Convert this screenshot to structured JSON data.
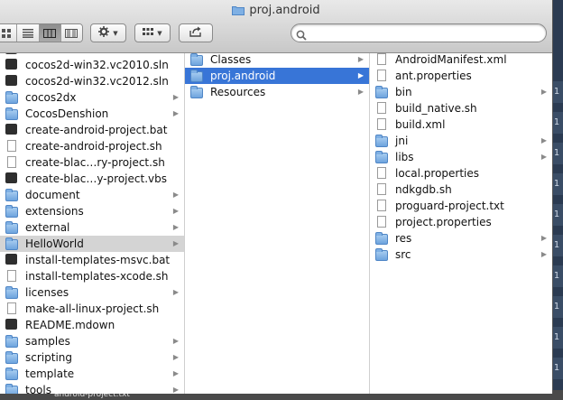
{
  "window": {
    "title": "proj.android",
    "search": {
      "value": "",
      "placeholder": ""
    }
  },
  "toolbar": {
    "view_modes": [
      "icon-view-icon",
      "list-view-icon",
      "column-view-icon",
      "coverflow-view-icon"
    ],
    "active_view": "column-view-icon",
    "action_icon": "gear-icon",
    "arrange_icon": "arrange-grid-icon",
    "share_icon": "share-icon"
  },
  "column1": {
    "partial_top_label": "cocos2d-win32.vc2010.sln",
    "items": [
      {
        "label": "cocos2d-win32.vc2010.sln",
        "kind": "exec",
        "arrow": false
      },
      {
        "label": "cocos2d-win32.vc2012.sln",
        "kind": "exec",
        "arrow": false
      },
      {
        "label": "cocos2dx",
        "kind": "folder",
        "arrow": true
      },
      {
        "label": "CocosDenshion",
        "kind": "folder",
        "arrow": true
      },
      {
        "label": "create-android-project.bat",
        "kind": "exec",
        "arrow": false
      },
      {
        "label": "create-android-project.sh",
        "kind": "doc",
        "arrow": false
      },
      {
        "label": "create-blac…ry-project.sh",
        "kind": "doc",
        "arrow": false
      },
      {
        "label": "create-blac…y-project.vbs",
        "kind": "exec",
        "arrow": false
      },
      {
        "label": "document",
        "kind": "folder",
        "arrow": true
      },
      {
        "label": "extensions",
        "kind": "folder",
        "arrow": true
      },
      {
        "label": "external",
        "kind": "folder",
        "arrow": true
      },
      {
        "label": "HelloWorld",
        "kind": "folder",
        "arrow": true,
        "selected": "gray"
      },
      {
        "label": "install-templates-msvc.bat",
        "kind": "exec",
        "arrow": false
      },
      {
        "label": "install-templates-xcode.sh",
        "kind": "doc",
        "arrow": false
      },
      {
        "label": "licenses",
        "kind": "folder",
        "arrow": true
      },
      {
        "label": "make-all-linux-project.sh",
        "kind": "doc",
        "arrow": false
      },
      {
        "label": "README.mdown",
        "kind": "exec",
        "arrow": false
      },
      {
        "label": "samples",
        "kind": "folder",
        "arrow": true
      },
      {
        "label": "scripting",
        "kind": "folder",
        "arrow": true
      },
      {
        "label": "template",
        "kind": "folder",
        "arrow": true
      },
      {
        "label": "tools",
        "kind": "folder",
        "arrow": true
      }
    ]
  },
  "column2": {
    "items": [
      {
        "label": "Classes",
        "kind": "folder",
        "arrow": true
      },
      {
        "label": "proj.android",
        "kind": "folder",
        "arrow": true,
        "selected": "blue"
      },
      {
        "label": "Resources",
        "kind": "folder",
        "arrow": true
      }
    ]
  },
  "column3": {
    "items": [
      {
        "label": "AndroidManifest.xml",
        "kind": "doc",
        "arrow": false
      },
      {
        "label": "ant.properties",
        "kind": "doc",
        "arrow": false
      },
      {
        "label": "bin",
        "kind": "folder",
        "arrow": true
      },
      {
        "label": "build_native.sh",
        "kind": "doc",
        "arrow": false
      },
      {
        "label": "build.xml",
        "kind": "doc",
        "arrow": false
      },
      {
        "label": "jni",
        "kind": "folder",
        "arrow": true
      },
      {
        "label": "libs",
        "kind": "folder",
        "arrow": true
      },
      {
        "label": "local.properties",
        "kind": "doc",
        "arrow": false
      },
      {
        "label": "ndkgdb.sh",
        "kind": "doc",
        "arrow": false
      },
      {
        "label": "proguard-project.txt",
        "kind": "doc",
        "arrow": false
      },
      {
        "label": "project.properties",
        "kind": "doc",
        "arrow": false
      },
      {
        "label": "res",
        "kind": "folder",
        "arrow": true
      },
      {
        "label": "src",
        "kind": "folder",
        "arrow": true
      }
    ]
  },
  "background": {
    "bottom_text": "android-project.txt",
    "side_labels": [
      "1",
      "1",
      "1",
      "1",
      "1",
      "1",
      "1",
      "1",
      "1",
      "1"
    ]
  },
  "colors": {
    "selection_blue": "#3875d7",
    "selection_gray": "#d4d4d4"
  }
}
